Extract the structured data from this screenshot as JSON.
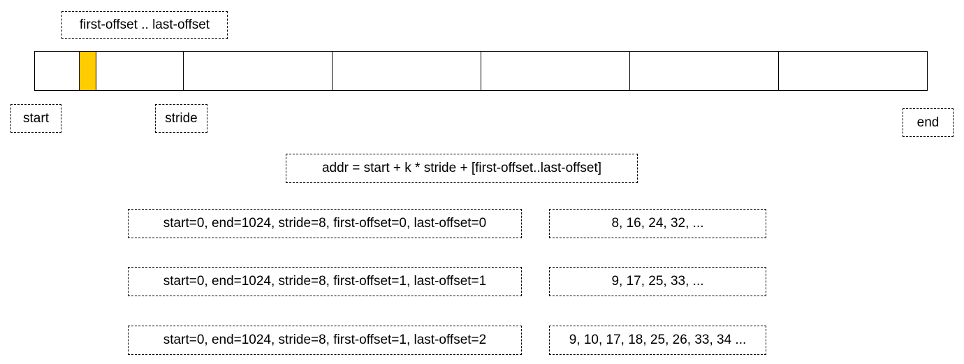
{
  "labels": {
    "offset_range": "first-offset .. last-offset",
    "start": "start",
    "stride": "stride",
    "end": "end",
    "formula": "addr = start + k * stride + [first-offset..last-offset]"
  },
  "colors": {
    "highlight": "#FFCC00",
    "border": "#000000"
  },
  "examples": [
    {
      "params": "start=0, end=1024, stride=8, first-offset=0, last-offset=0",
      "result": "8, 16, 24, 32, ..."
    },
    {
      "params": "start=0, end=1024, stride=8, first-offset=1, last-offset=1",
      "result": "9, 17, 25, 33, ..."
    },
    {
      "params": "start=0, end=1024, stride=8, first-offset=1, last-offset=2",
      "result": "9, 10, 17, 18, 25, 26, 33, 34 ..."
    }
  ]
}
